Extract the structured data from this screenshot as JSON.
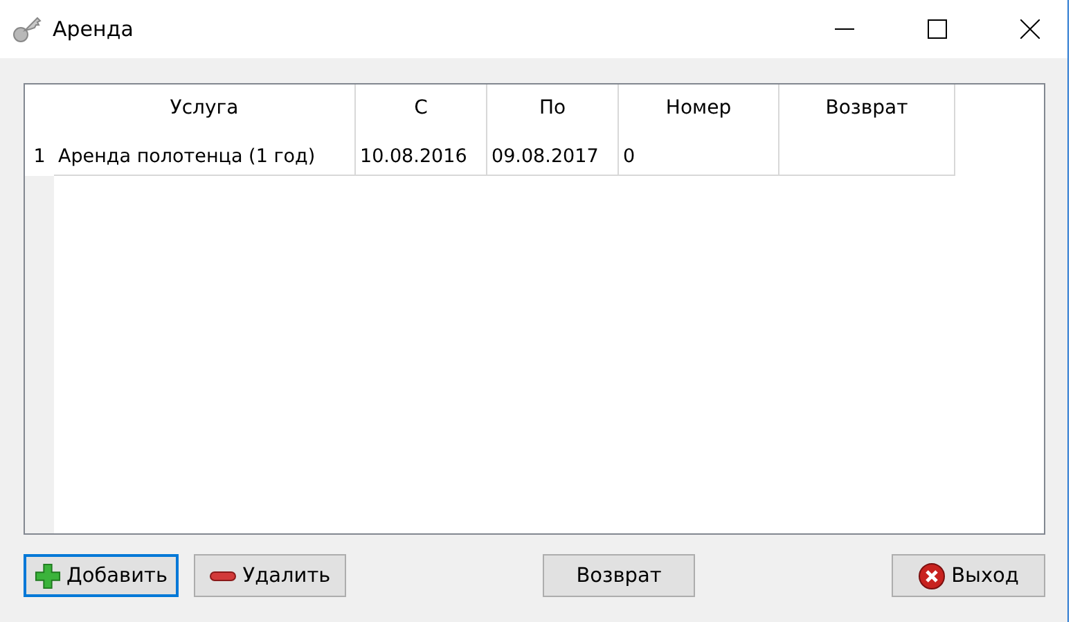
{
  "window": {
    "title": "Аренда"
  },
  "table": {
    "columns": [
      "Услуга",
      "С",
      "По",
      "Номер",
      "Возврат"
    ],
    "rows": [
      {
        "number": "1",
        "cells": [
          "Аренда полотенца (1 год)",
          "10.08.2016",
          "09.08.2017",
          "0",
          ""
        ]
      }
    ]
  },
  "buttons": [
    {
      "label": "Добавить",
      "kind": "add",
      "focused": true
    },
    {
      "label": "Удалить",
      "kind": "remove",
      "focused": false
    },
    {
      "label": "Возврат",
      "kind": "plain",
      "focused": false
    },
    {
      "label": "Выход",
      "kind": "exit",
      "focused": false
    }
  ]
}
